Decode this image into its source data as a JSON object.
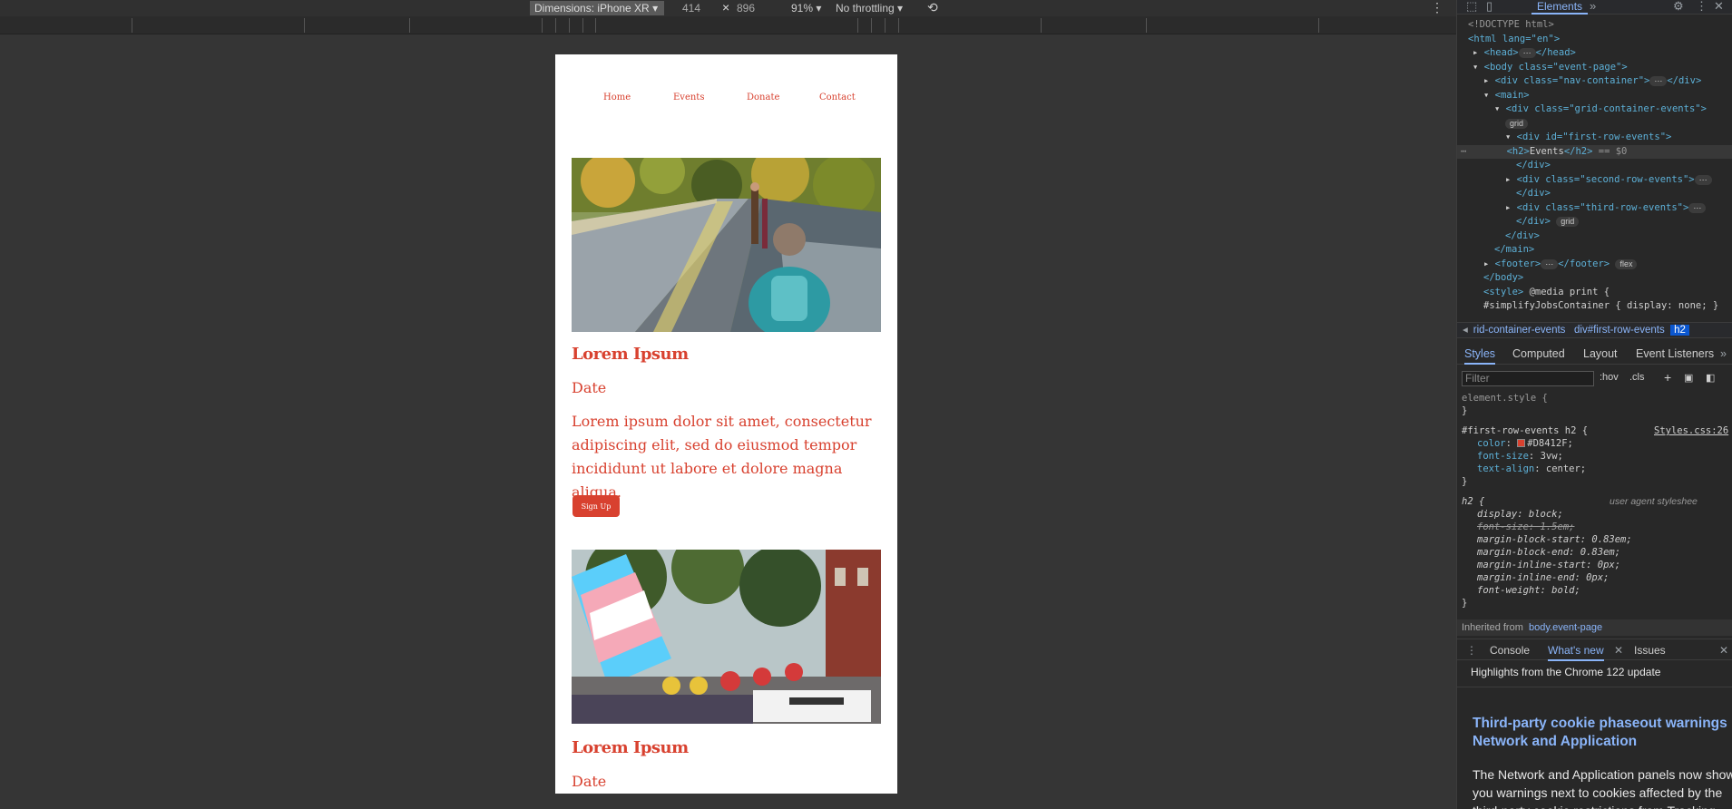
{
  "device_toolbar": {
    "dimensions_label": "Dimensions: iPhone XR",
    "width": "414",
    "times": "×",
    "height": "896",
    "zoom": "91%",
    "throttling": "No throttling",
    "rotate_icon": "rotate-icon",
    "more_icon": "kebab-icon"
  },
  "page": {
    "nav": [
      "Home",
      "Events",
      "Donate",
      "Contact"
    ],
    "events": [
      {
        "title": "Lorem Ipsum",
        "date": "Date",
        "description": "Lorem ipsum dolor sit amet, consectetur adipiscing elit, sed do eiusmod tempor incididunt ut labore et dolore magna aliqua.",
        "button": "Sign Up",
        "image": "bridge-walk-photo"
      },
      {
        "title": "Lorem Ipsum",
        "date": "Date",
        "image": "pride-parade-photo"
      }
    ],
    "accent_color": "#D8412F"
  },
  "devtools": {
    "panel_tab": "Elements",
    "dom": {
      "doctype": "<!DOCTYPE html>",
      "html_open": "<html lang=\"en\">",
      "head": "<head>",
      "head_close": "</head>",
      "body_open": "<body class=\"event-page\">",
      "nav_div": "<div class=\"nav-container\">",
      "nav_div_close": "</div>",
      "main_open": "<main>",
      "grid_div": "<div class=\"grid-container-events\">",
      "grid_badge": "grid",
      "first_row": "<div id=\"first-row-events\">",
      "h2_open": "<h2>",
      "h2_text": "Events",
      "h2_close": "</h2>",
      "selected_marker": "== $0",
      "div_close": "</div>",
      "second_row": "<div class=\"second-row-events\">",
      "third_row": "<div class=\"third-row-events\">",
      "main_close": "</main>",
      "footer": "<footer>",
      "footer_close": "</footer>",
      "flex_badge": "flex",
      "body_close": "</body>",
      "style_open": "<style>",
      "style_media": "@media print {",
      "style_rule": "#simplifyJobsContainer { display: none; }"
    },
    "breadcrumbs": [
      "rid-container-events",
      "div#first-row-events",
      "h2"
    ],
    "style_tabs": [
      "Styles",
      "Computed",
      "Layout",
      "Event Listeners"
    ],
    "filter_placeholder": "Filter",
    "filter_options": [
      ":hov",
      ".cls"
    ],
    "rules": {
      "element_style": "element.style {",
      "close_brace": "}",
      "rule1_selector": "#first-row-events h2 {",
      "rule1_source": "Styles.css:26",
      "color_prop": "color",
      "color_val": "#D8412F;",
      "fontsize_prop": "font-size",
      "fontsize_val": "3vw;",
      "align_prop": "text-align",
      "align_val": "center;",
      "ua_selector": "h2 {",
      "ua_source": "user agent styleshee",
      "ua_display": "display: block;",
      "ua_fontsize": "font-size: 1.5em;",
      "ua_mbs": "margin-block-start: 0.83em;",
      "ua_mbe": "margin-block-end: 0.83em;",
      "ua_mis": "margin-inline-start: 0px;",
      "ua_mie": "margin-inline-end: 0px;",
      "ua_weight": "font-weight: bold;"
    },
    "inherited_label": "Inherited from",
    "inherited_link": "body.event-page",
    "drawer_tabs": [
      "Console",
      "What's new",
      "Issues"
    ],
    "highlights": "Highlights from the Chrome 122 update",
    "whatsnew_title": "Third-party cookie phaseout warnings in Network and Application",
    "whatsnew_body": "The Network and Application panels now show you warnings next to cookies affected by the third-party cookie restrictions from Tracking"
  }
}
